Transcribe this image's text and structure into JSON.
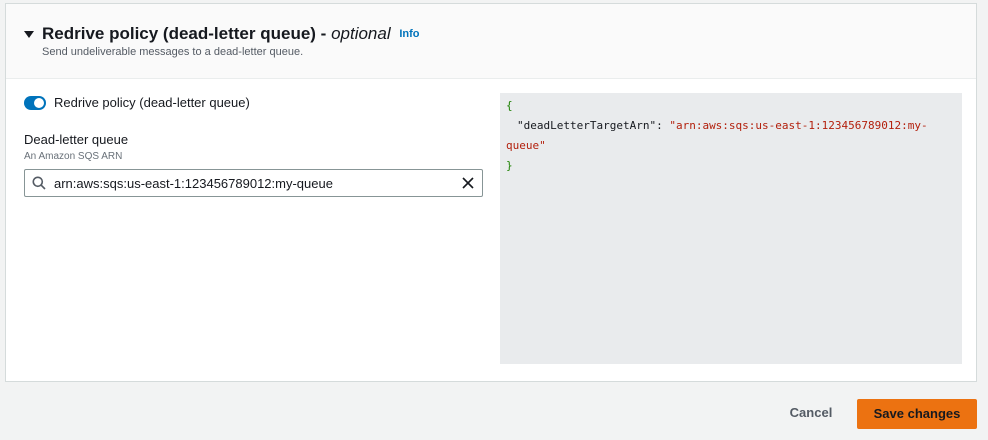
{
  "section": {
    "title": "Redrive policy (dead-letter queue)",
    "separator": " - ",
    "optional_label": "optional",
    "info_link": "Info",
    "description": "Send undeliverable messages to a dead-letter queue."
  },
  "toggle": {
    "label": "Redrive policy (dead-letter queue)",
    "enabled": true
  },
  "dead_letter_queue": {
    "label": "Dead-letter queue",
    "sublabel": "An Amazon SQS ARN",
    "value": "arn:aws:sqs:us-east-1:123456789012:my-queue"
  },
  "json_preview": {
    "open_brace": "{",
    "key": "\"deadLetterTargetArn\"",
    "colon": ": ",
    "value_line1": "\"arn:aws:sqs:us-east-1:123456789012:my-",
    "value_line2": "queue\"",
    "close_brace": "}"
  },
  "actions": {
    "cancel_label": "Cancel",
    "save_label": "Save changes"
  },
  "colors": {
    "accent": "#0073bb",
    "primary_button": "#ec7211",
    "json_brace": "#1d8102",
    "json_string": "#b3200d"
  },
  "icons": {
    "caret": "caret-down-icon",
    "search": "search-icon",
    "clear": "close-icon"
  }
}
